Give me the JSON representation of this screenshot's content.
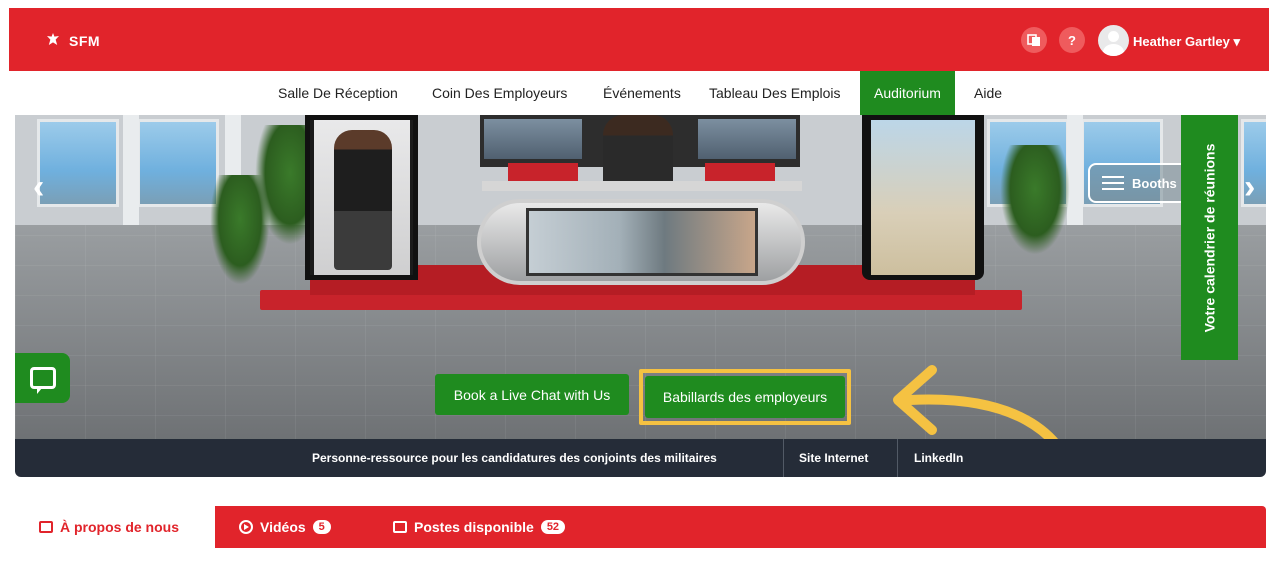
{
  "brand": {
    "logo_text": "SFM",
    "primary_color": "#e1242b",
    "accent_green": "#1f8b1f",
    "highlight_color": "#f5c242"
  },
  "header": {
    "icons": [
      "language-icon",
      "help-icon"
    ],
    "help_label": "?",
    "user_name": "Heather Gartley",
    "user_menu_caret": "▾"
  },
  "nav": {
    "items": [
      {
        "label": "Salle De Réception",
        "active": false
      },
      {
        "label": "Coin Des Employeurs",
        "active": false
      },
      {
        "label": "Événements",
        "active": false
      },
      {
        "label": "Tableau Des Emplois",
        "active": false
      },
      {
        "label": "Auditorium",
        "active": true
      },
      {
        "label": "Aide",
        "active": false
      }
    ]
  },
  "hero": {
    "prev_arrow": "‹",
    "next_arrow": "›",
    "booths_label": "Booths",
    "calendar_label": "Votre calendrier de réunions",
    "buttons": {
      "live_chat": "Book a Live Chat with Us",
      "boards": "Babillards des employeurs"
    }
  },
  "info_bar": {
    "links": [
      "Personne-ressource pour les candidatures des conjoints des militaires",
      "Site Internet",
      "LinkedIn"
    ]
  },
  "tabs": [
    {
      "label": "À propos de nous",
      "icon": "building-icon",
      "count": null,
      "active": true
    },
    {
      "label": "Vidéos",
      "icon": "play-icon",
      "count": "5",
      "active": false
    },
    {
      "label": "Postes disponible",
      "icon": "briefcase-icon",
      "count": "52",
      "active": false
    }
  ]
}
